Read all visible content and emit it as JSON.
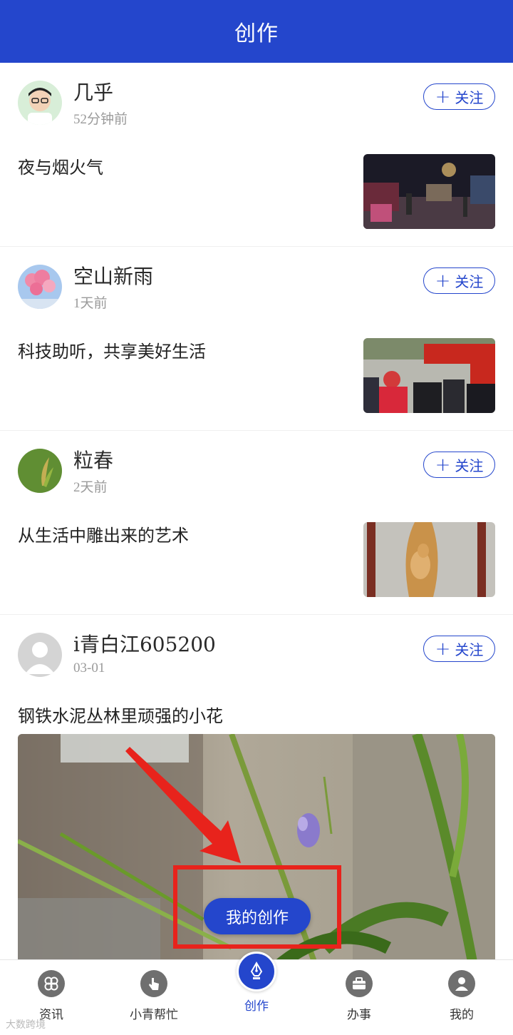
{
  "header": {
    "title": "创作"
  },
  "follow_label": "关注",
  "posts": [
    {
      "author": "几乎",
      "time": "52分钟前",
      "title": "夜与烟火气"
    },
    {
      "author": "空山新雨",
      "time": "1天前",
      "title": "科技助听，共享美好生活"
    },
    {
      "author": "粒春",
      "time": "2天前",
      "title": "从生活中雕出来的艺术"
    },
    {
      "author": "i青白江605200",
      "time": "03-01",
      "title": "钢铁水泥丛林里顽强的小花"
    }
  ],
  "popup": {
    "label": "我的创作"
  },
  "tabbar": [
    {
      "label": "资讯",
      "icon": "clover-icon"
    },
    {
      "label": "小青帮忙",
      "icon": "hand-icon"
    },
    {
      "label": "创作",
      "icon": "pen-nib-icon",
      "active": true
    },
    {
      "label": "办事",
      "icon": "briefcase-icon"
    },
    {
      "label": "我的",
      "icon": "person-icon"
    }
  ],
  "watermark": "大数跨境",
  "colors": {
    "brand": "#2446cc",
    "highlight": "#e8231c"
  }
}
